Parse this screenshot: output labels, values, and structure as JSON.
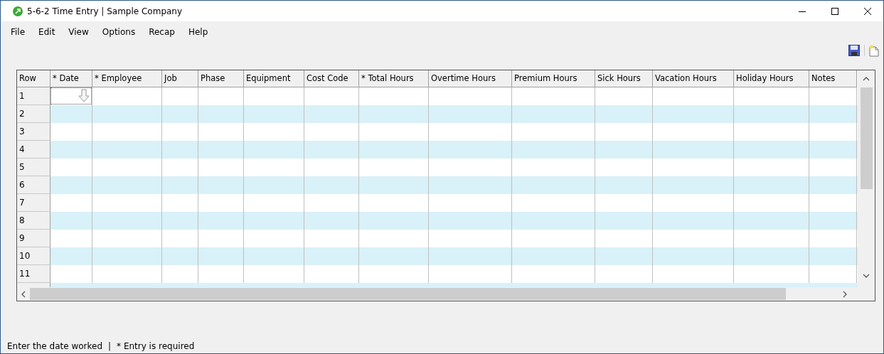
{
  "window": {
    "title": "5-6-2 Time Entry  |  Sample Company"
  },
  "menu": [
    "File",
    "Edit",
    "View",
    "Options",
    "Recap",
    "Help"
  ],
  "table": {
    "columns": [
      {
        "label": "Row"
      },
      {
        "label": "* Date"
      },
      {
        "label": "* Employee"
      },
      {
        "label": "Job"
      },
      {
        "label": "Phase"
      },
      {
        "label": "Equipment"
      },
      {
        "label": "Cost Code"
      },
      {
        "label": "* Total Hours"
      },
      {
        "label": "Overtime Hours"
      },
      {
        "label": "Premium Hours"
      },
      {
        "label": "Sick Hours"
      },
      {
        "label": "Vacation Hours"
      },
      {
        "label": "Holiday Hours"
      },
      {
        "label": "Notes"
      }
    ],
    "rows": [
      {
        "label": "1",
        "selected": true
      },
      {
        "label": "2",
        "selected": false
      },
      {
        "label": "3",
        "selected": false
      },
      {
        "label": "4",
        "selected": false
      },
      {
        "label": "5",
        "selected": false
      },
      {
        "label": "6",
        "selected": false
      },
      {
        "label": "7",
        "selected": false
      },
      {
        "label": "8",
        "selected": false
      },
      {
        "label": "9",
        "selected": false
      },
      {
        "label": "10",
        "selected": false
      },
      {
        "label": "11",
        "selected": false
      }
    ]
  },
  "status_bar": [
    "Enter the date worked",
    "|",
    "* Entry is required"
  ]
}
